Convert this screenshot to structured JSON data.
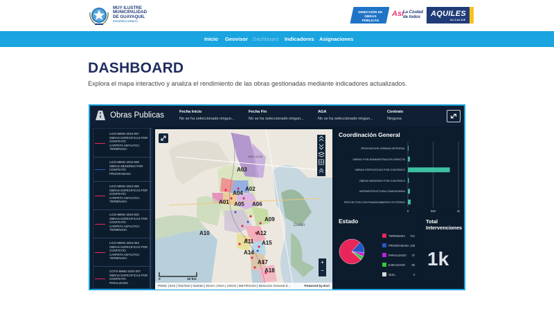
{
  "header": {
    "logo_text_lines": [
      "MUY ILUSTRE",
      "MUNICIPALIDAD",
      "DE GUAYAQUIL"
    ],
    "logo_subtext": "PROGRESO INFINITO",
    "dop_badge": "DIRECCIÓN DE OBRAS PÚBLICAS",
    "asi": "Así",
    "asi_tagline_1": "La Ciudad",
    "asi_tagline_2": "de todos",
    "aquiles": "AQUILES",
    "alcalde": "ALCALDE"
  },
  "nav": {
    "items": [
      "Inicio",
      "Geovisor",
      "Dashboard",
      "Indicadores",
      "Asignaciones"
    ],
    "active": "Dashboard"
  },
  "page": {
    "title": "DASHBOARD",
    "subtitle": "Explora el mapa interactivo y analiza el rendimiento de las obras gestionadas mediante indicadores actualizados."
  },
  "dashboard": {
    "title": "Obras Publicas",
    "filters": [
      {
        "label": "Fecha Inicio",
        "value": "No se ha seleccionado ningun..."
      },
      {
        "label": "Fecha Fin",
        "value": "No se ha seleccionado ningun..."
      },
      {
        "label": "AGA",
        "value": "No se ha seleccionado ningun..."
      },
      {
        "label": "Contrato",
        "value": "Ninguna"
      }
    ],
    "list": [
      {
        "lines": [
          "LICO-MIMG-2024-007",
          "OBRAS ESPECIFICAS POR",
          "CONTRATO",
          "CARPETA ASFALTICA",
          "TERMINADA"
        ],
        "color": "#e8265a"
      },
      {
        "lines": [
          "LICO-MIMG-2024-009",
          "OBRAS MENORES POR",
          "CONTRATO",
          "PROGRAMADA"
        ],
        "color": "#2a55c9"
      },
      {
        "lines": [
          "LICO-MIMG-2024-006",
          "OBRAS ESPECIFICAS POR",
          "CONTRATO",
          "CARPETA ASFALTICA",
          "TERMINADA"
        ],
        "color": "#e8265a"
      },
      {
        "lines": [
          "LICO-MIMG-2024-004",
          "OBRAS ESPECIFICAS POR",
          "CONTRATO",
          "CARPETA ASFALTICA",
          "TERMINADA"
        ],
        "color": "#e8265a"
      },
      {
        "lines": [
          "LICO-MIMG-2024-004",
          "OBRAS ESPECIFICAS POR",
          "CONTRATO",
          "CARPETA ASFALTICA",
          "TERMINADA"
        ],
        "color": "#e8265a"
      },
      {
        "lines": [
          "COTO-MIMG-2024-007",
          "OBRAS ESPECIFICAS POR",
          "CONTRATO",
          "PARALIZADO"
        ],
        "color": "#e8265a"
      }
    ],
    "map": {
      "areas": [
        "A01",
        "A02",
        "A03",
        "A04",
        "A05",
        "A06",
        "A09",
        "A10",
        "A11",
        "A12",
        "A14",
        "A15",
        "A17",
        "A18"
      ],
      "places": [
        "San Lucas",
        "Durán"
      ],
      "scale_left": "0",
      "scale_right": "10 km",
      "attribution": "PNNC | Esri | TomTom | Garmin | NASA | NGA | USGS | METI/NASA | Dirección General d...",
      "powered": "Powered by Esri"
    },
    "coordinacion": {
      "title": "Coordinación General",
      "chart_data": {
        "type": "bar",
        "orientation": "horizontal",
        "categories": [
          "RENOVACION URBANA INTEGRAL",
          "OBRAS POR ADMINISTRACION DIRECTA",
          "OBRAS ESPECIFICAS POR CONTRATO",
          "OBRAS MENORES POR CONTRATO",
          "INFRAESTRUCTURA COMUNITARIA",
          "PROYECTOS CON FINANCIAMIENTO EXTERNO"
        ],
        "values": [
          8,
          40,
          830,
          20,
          40,
          55
        ],
        "xticks": [
          "0",
          "500",
          "1k"
        ],
        "xlim": [
          0,
          1000
        ],
        "color": "#3dbfa2"
      }
    },
    "estado": {
      "title": "Estado",
      "chart_data": {
        "type": "pie",
        "labels": [
          "TERMINADA",
          "PROGRAMADA",
          "PARALIZADO",
          "EJECUCION",
          "NULL"
        ],
        "values": [
          741,
          149,
          47,
          50,
          3
        ],
        "colors": [
          "#e8265a",
          "#2a55c9",
          "#c020d8",
          "#3cc43c",
          "#d8d8d8"
        ]
      }
    },
    "total": {
      "title_1": "Total",
      "title_2": "Intervenciones",
      "value": "1k"
    }
  }
}
